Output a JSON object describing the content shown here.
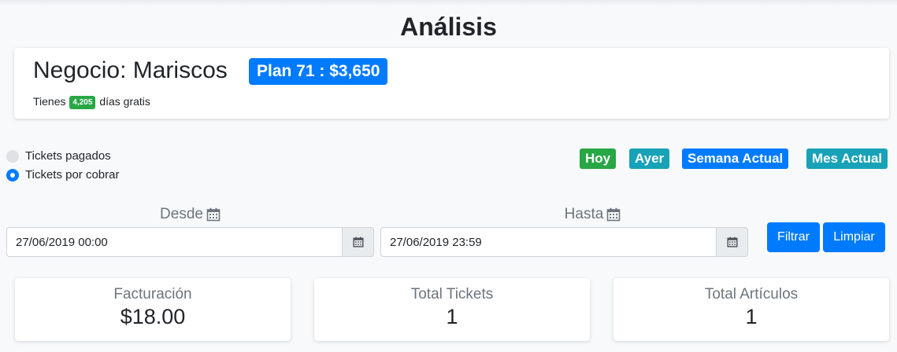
{
  "page": {
    "title": "Análisis"
  },
  "business": {
    "name": "Negocio: Mariscos",
    "plan": "Plan 71 : $3,650",
    "days_prefix": "Tienes",
    "days_free": "4,205",
    "days_suffix": "días gratis"
  },
  "ticket_filter": {
    "options": [
      {
        "label": "Tickets pagados",
        "selected": false
      },
      {
        "label": "Tickets por cobrar",
        "selected": true
      }
    ]
  },
  "quick_ranges": [
    {
      "label": "Hoy",
      "color": "#28a745"
    },
    {
      "label": "Ayer",
      "color": "#17a2b8"
    },
    {
      "label": "Semana Actual",
      "color": "#007bff"
    },
    {
      "label": "Mes Actual",
      "color": "#17a2b8"
    }
  ],
  "date_range": {
    "from_label": "Desde",
    "from_value": "27/06/2019 00:00",
    "to_label": "Hasta",
    "to_value": "27/06/2019 23:59"
  },
  "actions": {
    "filter_label": "Filtrar",
    "clear_label": "Limpiar"
  },
  "stats": [
    {
      "label": "Facturación",
      "value": "$18.00"
    },
    {
      "label": "Total Tickets",
      "value": "1"
    },
    {
      "label": "Total Artículos",
      "value": "1"
    }
  ],
  "icons": {
    "calendar": "calendar-icon"
  },
  "colors": {
    "primary": "#007bff",
    "success": "#28a745",
    "info": "#17a2b8",
    "muted": "#6c757d"
  }
}
